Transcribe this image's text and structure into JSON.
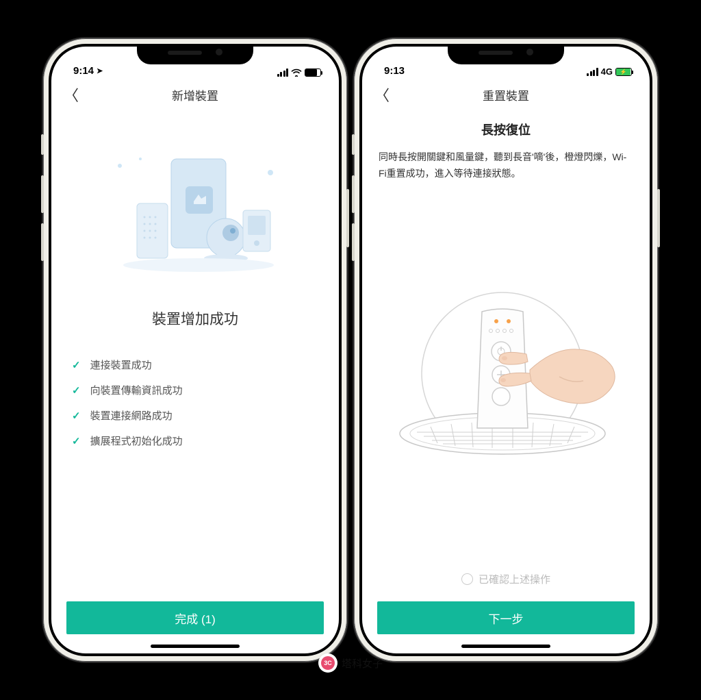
{
  "left": {
    "status": {
      "time": "9:14",
      "location_indicator": true,
      "net_type": "wifi"
    },
    "nav": {
      "title": "新增裝置"
    },
    "success_title": "裝置增加成功",
    "checks": [
      "連接裝置成功",
      "向裝置傳輸資訊成功",
      "裝置連接網路成功",
      "擴展程式初始化成功"
    ],
    "primary_button": "完成  (1)"
  },
  "right": {
    "status": {
      "time": "9:13",
      "net_label": "4G",
      "net_type": "4g",
      "charging": true
    },
    "nav": {
      "title": "重置裝置"
    },
    "sub_title": "長按復位",
    "sub_desc": "同時長按開關鍵和風量鍵，聽到長音'嘀'後，橙燈閃爍，Wi-Fi重置成功，進入等待連接狀態。",
    "confirm_label": "已確認上述操作",
    "primary_button": "下一步"
  },
  "watermark": {
    "badge": "3C",
    "text": "塔科女子"
  },
  "colors": {
    "accent": "#12b89a",
    "check": "#14b89a"
  }
}
